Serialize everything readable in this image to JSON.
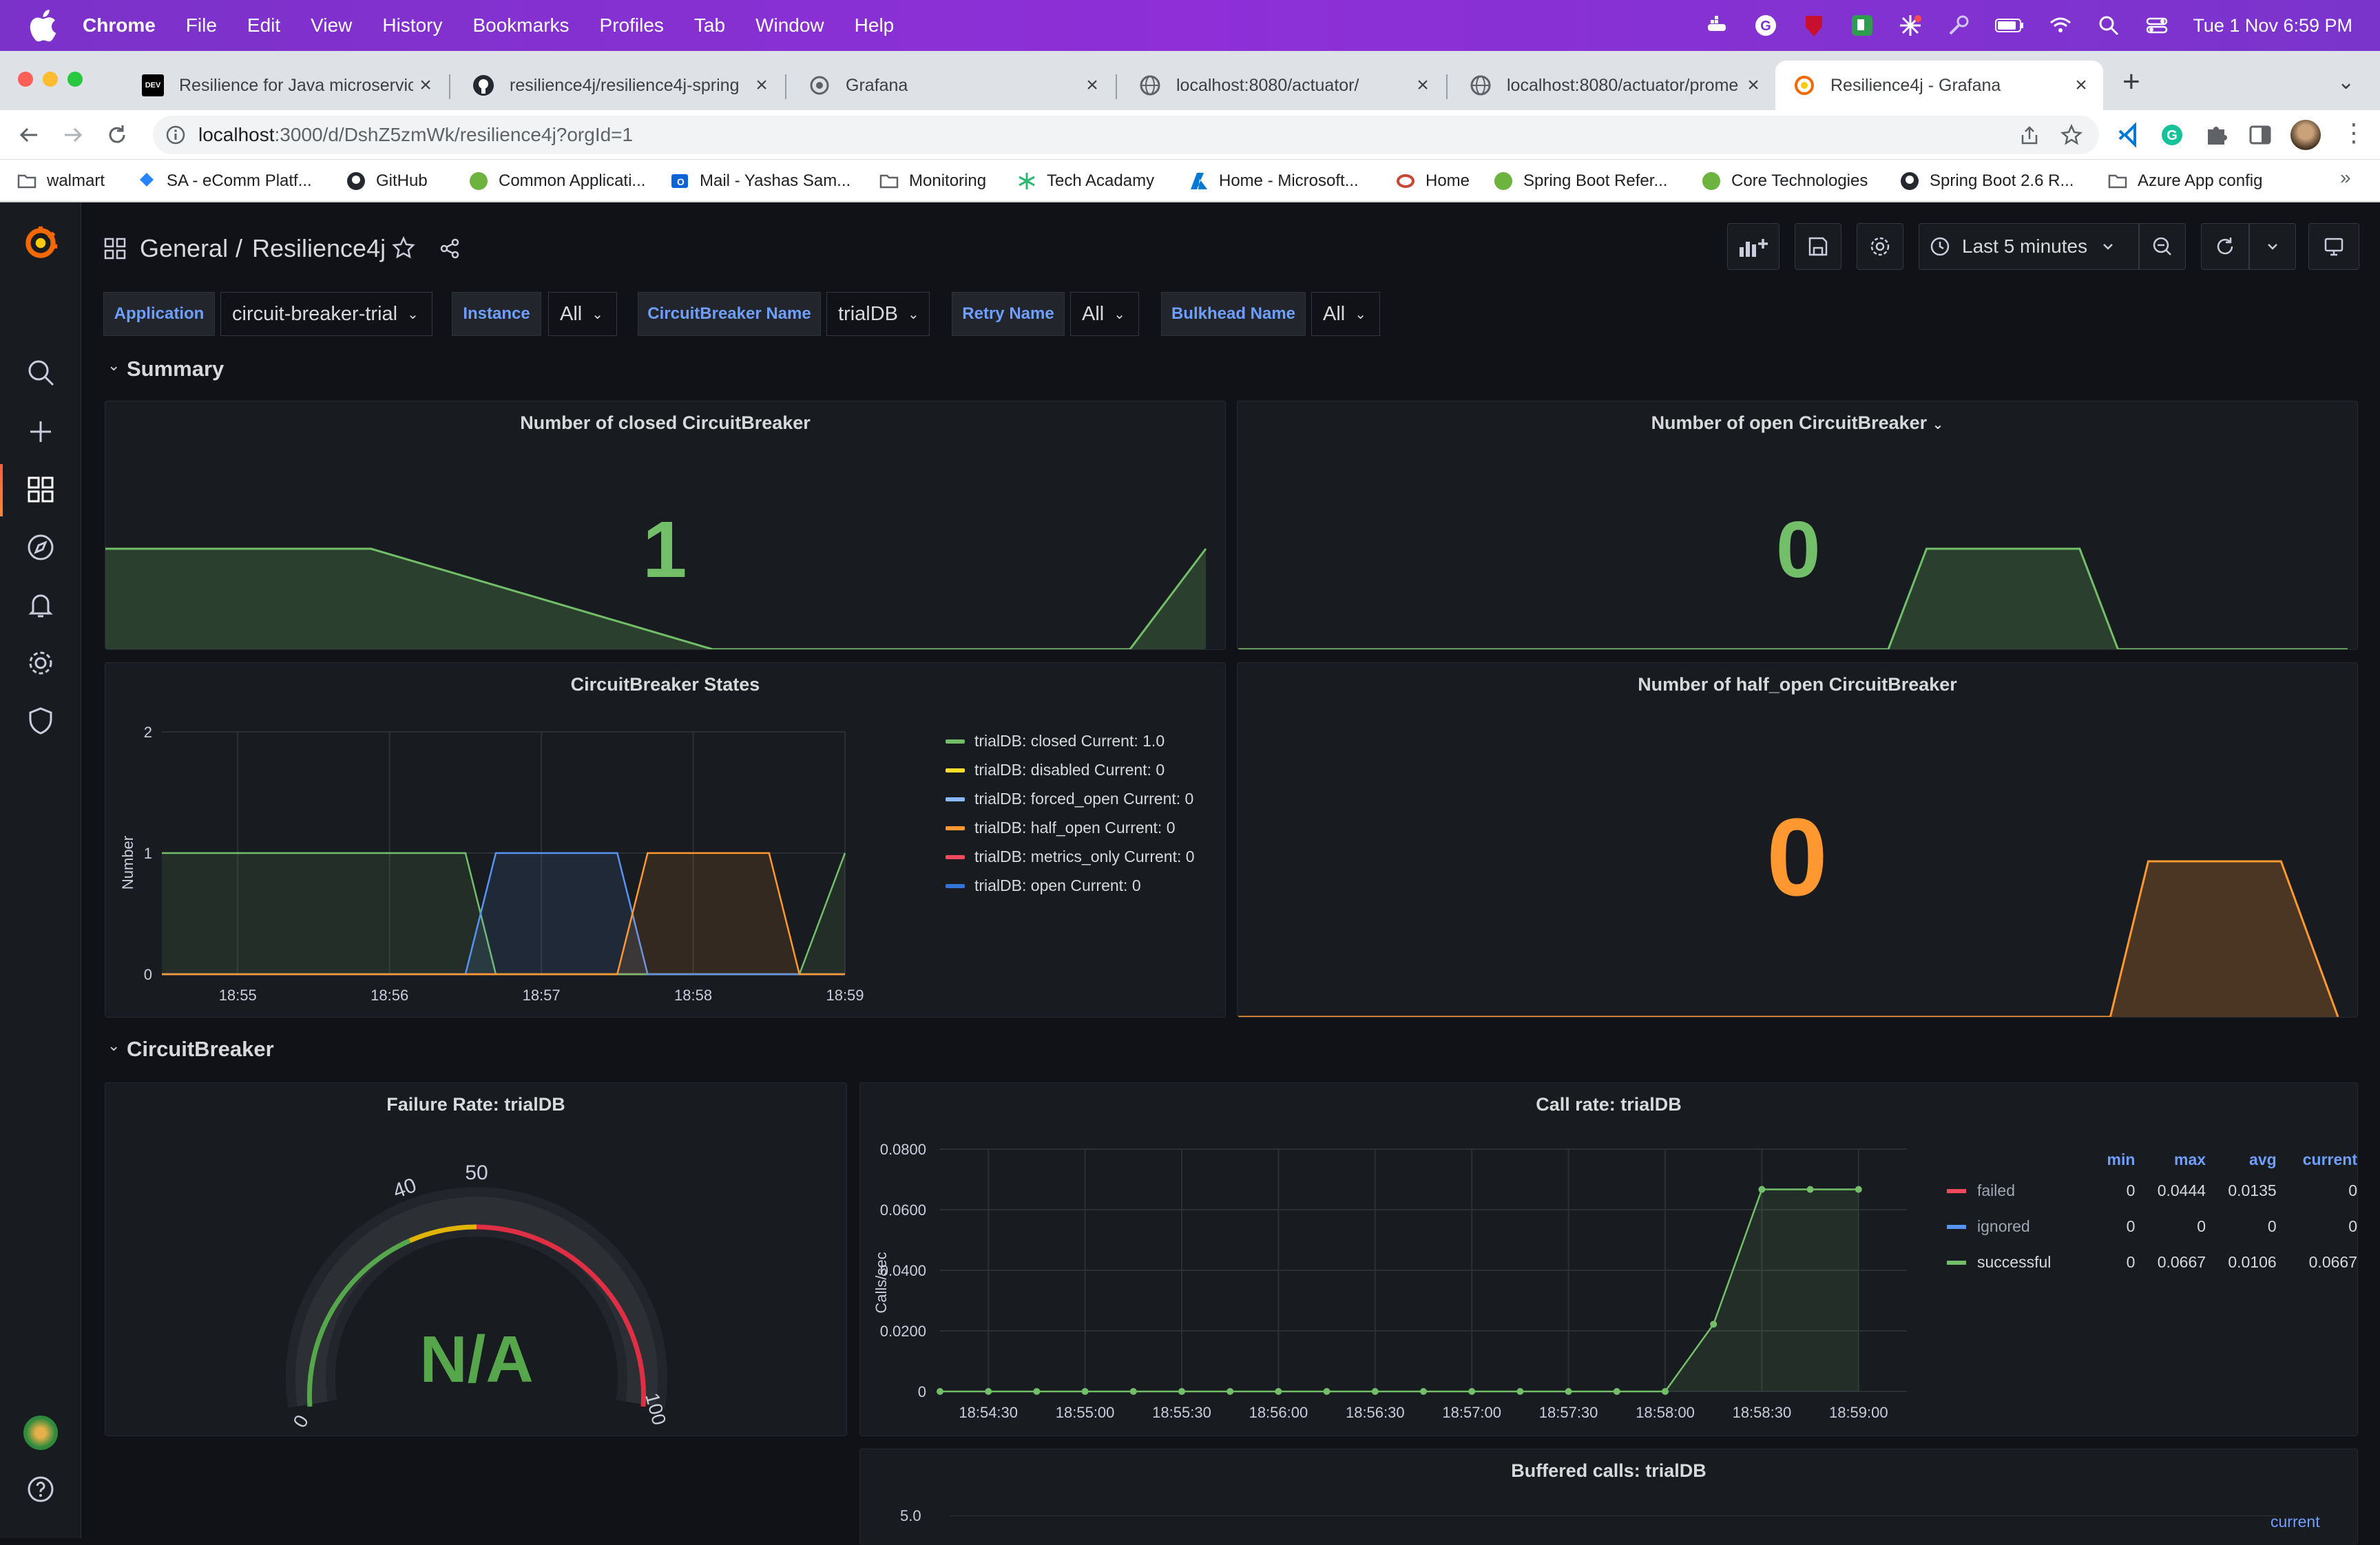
{
  "menubar": {
    "app": "Chrome",
    "items": [
      "File",
      "Edit",
      "View",
      "History",
      "Bookmarks",
      "Profiles",
      "Tab",
      "Window",
      "Help"
    ],
    "datetime": "Tue 1 Nov  6:59 PM"
  },
  "tabs": [
    {
      "title": "Resilience for Java microservic",
      "icon": "dev-icon"
    },
    {
      "title": "resilience4j/resilience4j-spring",
      "icon": "github-icon"
    },
    {
      "title": "Grafana",
      "icon": "grafana-icon"
    },
    {
      "title": "localhost:8080/actuator/",
      "icon": "globe-icon"
    },
    {
      "title": "localhost:8080/actuator/prome",
      "icon": "globe-icon"
    },
    {
      "title": "Resilience4j - Grafana",
      "icon": "grafana-icon"
    }
  ],
  "address": {
    "url_host": "localhost",
    "url_rest": ":3000/d/DshZ5zmWk/resilience4j?orgId=1"
  },
  "bookmarks": [
    "walmart",
    "SA - eComm Platf...",
    "GitHub",
    "Common Applicati...",
    "Mail - Yashas Sam...",
    "Monitoring",
    "Tech Acadamy",
    "Home - Microsoft...",
    "Home",
    "Spring Boot Refer...",
    "Core Technologies",
    "Spring Boot 2.6 R...",
    "Azure App config"
  ],
  "dashboard": {
    "folder": "General",
    "separator": "/",
    "title": "Resilience4j",
    "time_range": "Last 5 minutes",
    "variables": [
      {
        "label": "Application",
        "value": "circuit-breaker-trial"
      },
      {
        "label": "Instance",
        "value": "All"
      },
      {
        "label": "CircuitBreaker Name",
        "value": "trialDB"
      },
      {
        "label": "Retry Name",
        "value": "All"
      },
      {
        "label": "Bulkhead Name",
        "value": "All"
      }
    ],
    "rows": {
      "summary": "Summary",
      "circuitbreaker": "CircuitBreaker"
    }
  },
  "panels": {
    "closed": {
      "title": "Number of closed CircuitBreaker",
      "value": "1",
      "color": "#73bf69"
    },
    "open": {
      "title": "Number of open CircuitBreaker",
      "value": "0",
      "color": "#73bf69"
    },
    "states": {
      "title": "CircuitBreaker States",
      "ylabel": "Number",
      "legend": [
        {
          "text": "trialDB: closed  Current: 1.0",
          "color": "#73bf69"
        },
        {
          "text": "trialDB: disabled  Current: 0",
          "color": "#fade2a"
        },
        {
          "text": "trialDB: forced_open  Current: 0",
          "color": "#5794f2"
        },
        {
          "text": "trialDB: half_open  Current: 0",
          "color": "#ff9830"
        },
        {
          "text": "trialDB: metrics_only  Current: 0",
          "color": "#f2495c"
        },
        {
          "text": "trialDB: open  Current: 0",
          "color": "#3274d9"
        }
      ]
    },
    "half_open": {
      "title": "Number of half_open CircuitBreaker",
      "value": "0",
      "color": "#ff9830"
    },
    "failure_rate": {
      "title": "Failure Rate: trialDB",
      "value": "N/A",
      "thresholds": [
        "0",
        "40",
        "50",
        "100"
      ],
      "color": "#73bf69"
    },
    "call_rate": {
      "title": "Call rate: trialDB",
      "ylabel": "Calls/sec",
      "legend_headers": [
        "min",
        "max",
        "avg",
        "current"
      ],
      "legend": [
        {
          "name": "failed",
          "color": "#f2495c",
          "min": "0",
          "max": "0.0444",
          "avg": "0.0135",
          "current": "0"
        },
        {
          "name": "ignored",
          "color": "#5794f2",
          "min": "0",
          "max": "0",
          "avg": "0",
          "current": "0"
        },
        {
          "name": "successful",
          "color": "#73bf69",
          "min": "0",
          "max": "0.0667",
          "avg": "0.0106",
          "current": "0.0667"
        }
      ]
    },
    "buffered": {
      "title": "Buffered calls: trialDB",
      "y_top": "5.0",
      "legend_header": "current"
    }
  },
  "chart_data": [
    {
      "type": "area",
      "title": "Number of closed CircuitBreaker",
      "series": [
        {
          "name": "closed",
          "x": [
            "18:54:10",
            "18:55:20",
            "18:56:50",
            "18:57:00",
            "18:58:40",
            "18:59:00"
          ],
          "values": [
            1,
            1,
            0,
            0,
            0,
            1
          ]
        }
      ]
    },
    {
      "type": "area",
      "title": "Number of open CircuitBreaker",
      "series": [
        {
          "name": "open",
          "x": [
            "18:54:10",
            "18:57:00",
            "18:57:10",
            "18:57:50",
            "18:58:00",
            "18:59:00"
          ],
          "values": [
            0,
            0,
            1,
            1,
            0,
            0
          ]
        }
      ]
    },
    {
      "type": "line",
      "title": "CircuitBreaker States",
      "x": [
        "18:54:30",
        "18:55",
        "18:56",
        "18:56:30",
        "18:56:42",
        "18:57",
        "18:57:30",
        "18:57:42",
        "18:58",
        "18:58:30",
        "18:58:42",
        "18:59"
      ],
      "xticks": [
        "18:55",
        "18:56",
        "18:57",
        "18:58",
        "18:59"
      ],
      "yticks": [
        "0",
        "1",
        "2"
      ],
      "ylim": [
        0,
        2
      ],
      "series": [
        {
          "name": "trialDB: closed",
          "values": [
            1,
            1,
            1,
            1,
            0,
            0,
            0,
            0,
            0,
            0,
            0,
            1
          ]
        },
        {
          "name": "trialDB: open",
          "values": [
            0,
            0,
            0,
            0,
            1,
            1,
            1,
            0,
            0,
            0,
            0,
            0
          ]
        },
        {
          "name": "trialDB: half_open",
          "values": [
            0,
            0,
            0,
            0,
            0,
            0,
            0,
            1,
            1,
            1,
            0,
            0
          ]
        },
        {
          "name": "trialDB: disabled",
          "values": [
            0,
            0,
            0,
            0,
            0,
            0,
            0,
            0,
            0,
            0,
            0,
            0
          ]
        },
        {
          "name": "trialDB: forced_open",
          "values": [
            0,
            0,
            0,
            0,
            0,
            0,
            0,
            0,
            0,
            0,
            0,
            0
          ]
        },
        {
          "name": "trialDB: metrics_only",
          "values": [
            0,
            0,
            0,
            0,
            0,
            0,
            0,
            0,
            0,
            0,
            0,
            0
          ]
        }
      ]
    },
    {
      "type": "area",
      "title": "Number of half_open CircuitBreaker",
      "series": [
        {
          "name": "half_open",
          "x": [
            "18:54:10",
            "18:58:00",
            "18:58:10",
            "18:58:45",
            "18:59:00"
          ],
          "values": [
            0,
            0,
            1,
            1,
            0
          ]
        }
      ]
    },
    {
      "type": "line",
      "title": "Call rate: trialDB",
      "xticks": [
        "18:54:30",
        "18:55:00",
        "18:55:30",
        "18:56:00",
        "18:56:30",
        "18:57:00",
        "18:57:30",
        "18:58:00",
        "18:58:30",
        "18:59:00"
      ],
      "yticks": [
        "0",
        "0.0200",
        "0.0400",
        "0.0600",
        "0.0800"
      ],
      "ylim": [
        0,
        0.08
      ],
      "series": [
        {
          "name": "successful",
          "x": [
            "18:54:15",
            "18:54:30",
            "18:54:45",
            "18:55:00",
            "18:55:15",
            "18:55:30",
            "18:55:45",
            "18:56:00",
            "18:56:15",
            "18:56:30",
            "18:56:45",
            "18:57:00",
            "18:57:15",
            "18:57:30",
            "18:57:45",
            "18:58:00",
            "18:58:15",
            "18:58:30",
            "18:58:45",
            "18:59:00"
          ],
          "values": [
            0,
            0,
            0,
            0,
            0,
            0,
            0,
            0,
            0,
            0,
            0,
            0,
            0,
            0,
            0,
            0,
            0.0222,
            0.0667,
            0.0667,
            0.0667
          ]
        }
      ]
    }
  ]
}
